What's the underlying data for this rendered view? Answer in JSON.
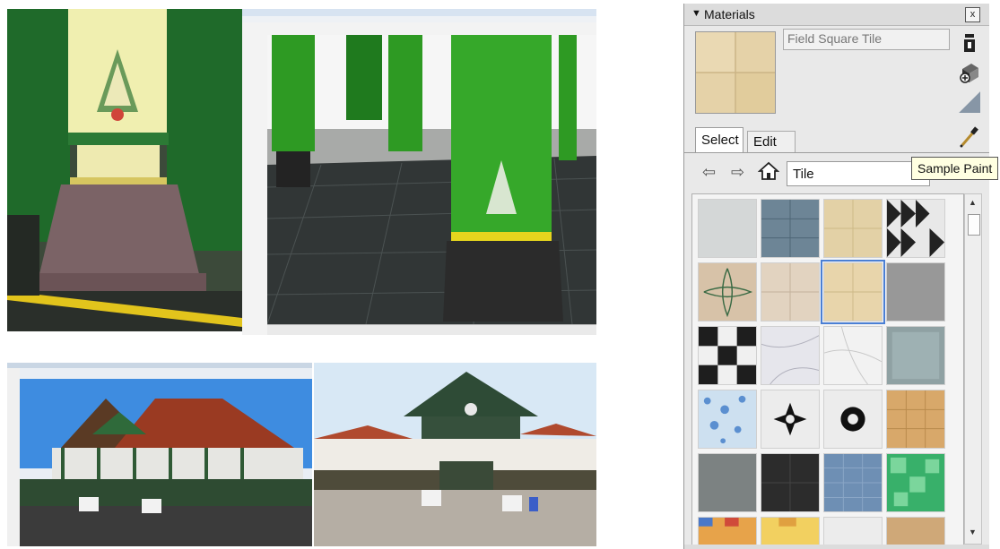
{
  "materials_panel": {
    "title": "Materials",
    "collapse_icon": "triangle-down-icon",
    "close_label": "x",
    "material_name": "Field Square Tile",
    "tabs": [
      {
        "label": "Select",
        "active": true
      },
      {
        "label": "Edit",
        "active": false
      }
    ],
    "library": "Tile",
    "tooltip": "Sample Paint",
    "icons": [
      "paint-bucket-icon",
      "create-material-icon",
      "back-color-icon",
      "eyedropper-icon",
      "back-arrow-icon",
      "forward-arrow-icon",
      "home-icon"
    ],
    "selected_swatch": 6,
    "colors": {
      "selection": "#4a7fd4",
      "panel": "#e9e9e9",
      "tooltip": "#ffffe1"
    }
  }
}
